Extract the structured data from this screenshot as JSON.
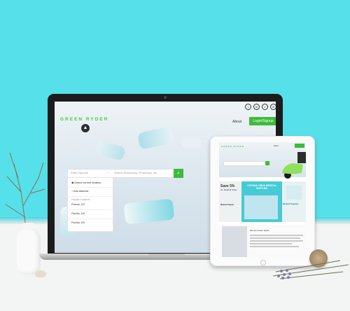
{
  "site": {
    "logo_text": "GREEN RYDER",
    "nav_about": "About",
    "login_button": "Login/Signup",
    "social_icons": [
      "twitter-icon",
      "instagram-icon",
      "facebook-icon",
      "phone-icon"
    ]
  },
  "search": {
    "location_placeholder": "Enter Zipcode",
    "query_placeholder": "Search Dispensary, Pharmacy, etc."
  },
  "dropdown": {
    "detect_location": "Detect current location",
    "add_address": "Add address",
    "popular_header": "Popular Locations",
    "locations": [
      "Florida, US",
      "Florida, US",
      "Florida, US"
    ]
  },
  "tablet": {
    "save_title": "Save 5%",
    "save_sub": "On Medical Order",
    "corona_title": "CORONA VIRUS MEDICAL SUPPLIES",
    "medical_supplies": "Medical Supplies",
    "medical_label": "Medical Supply",
    "section_title": "We Are Green Ryder"
  },
  "colors": {
    "accent_green": "#3dbb3b",
    "background_cyan": "#56e0ea",
    "promo_teal": "#46cbd6"
  }
}
